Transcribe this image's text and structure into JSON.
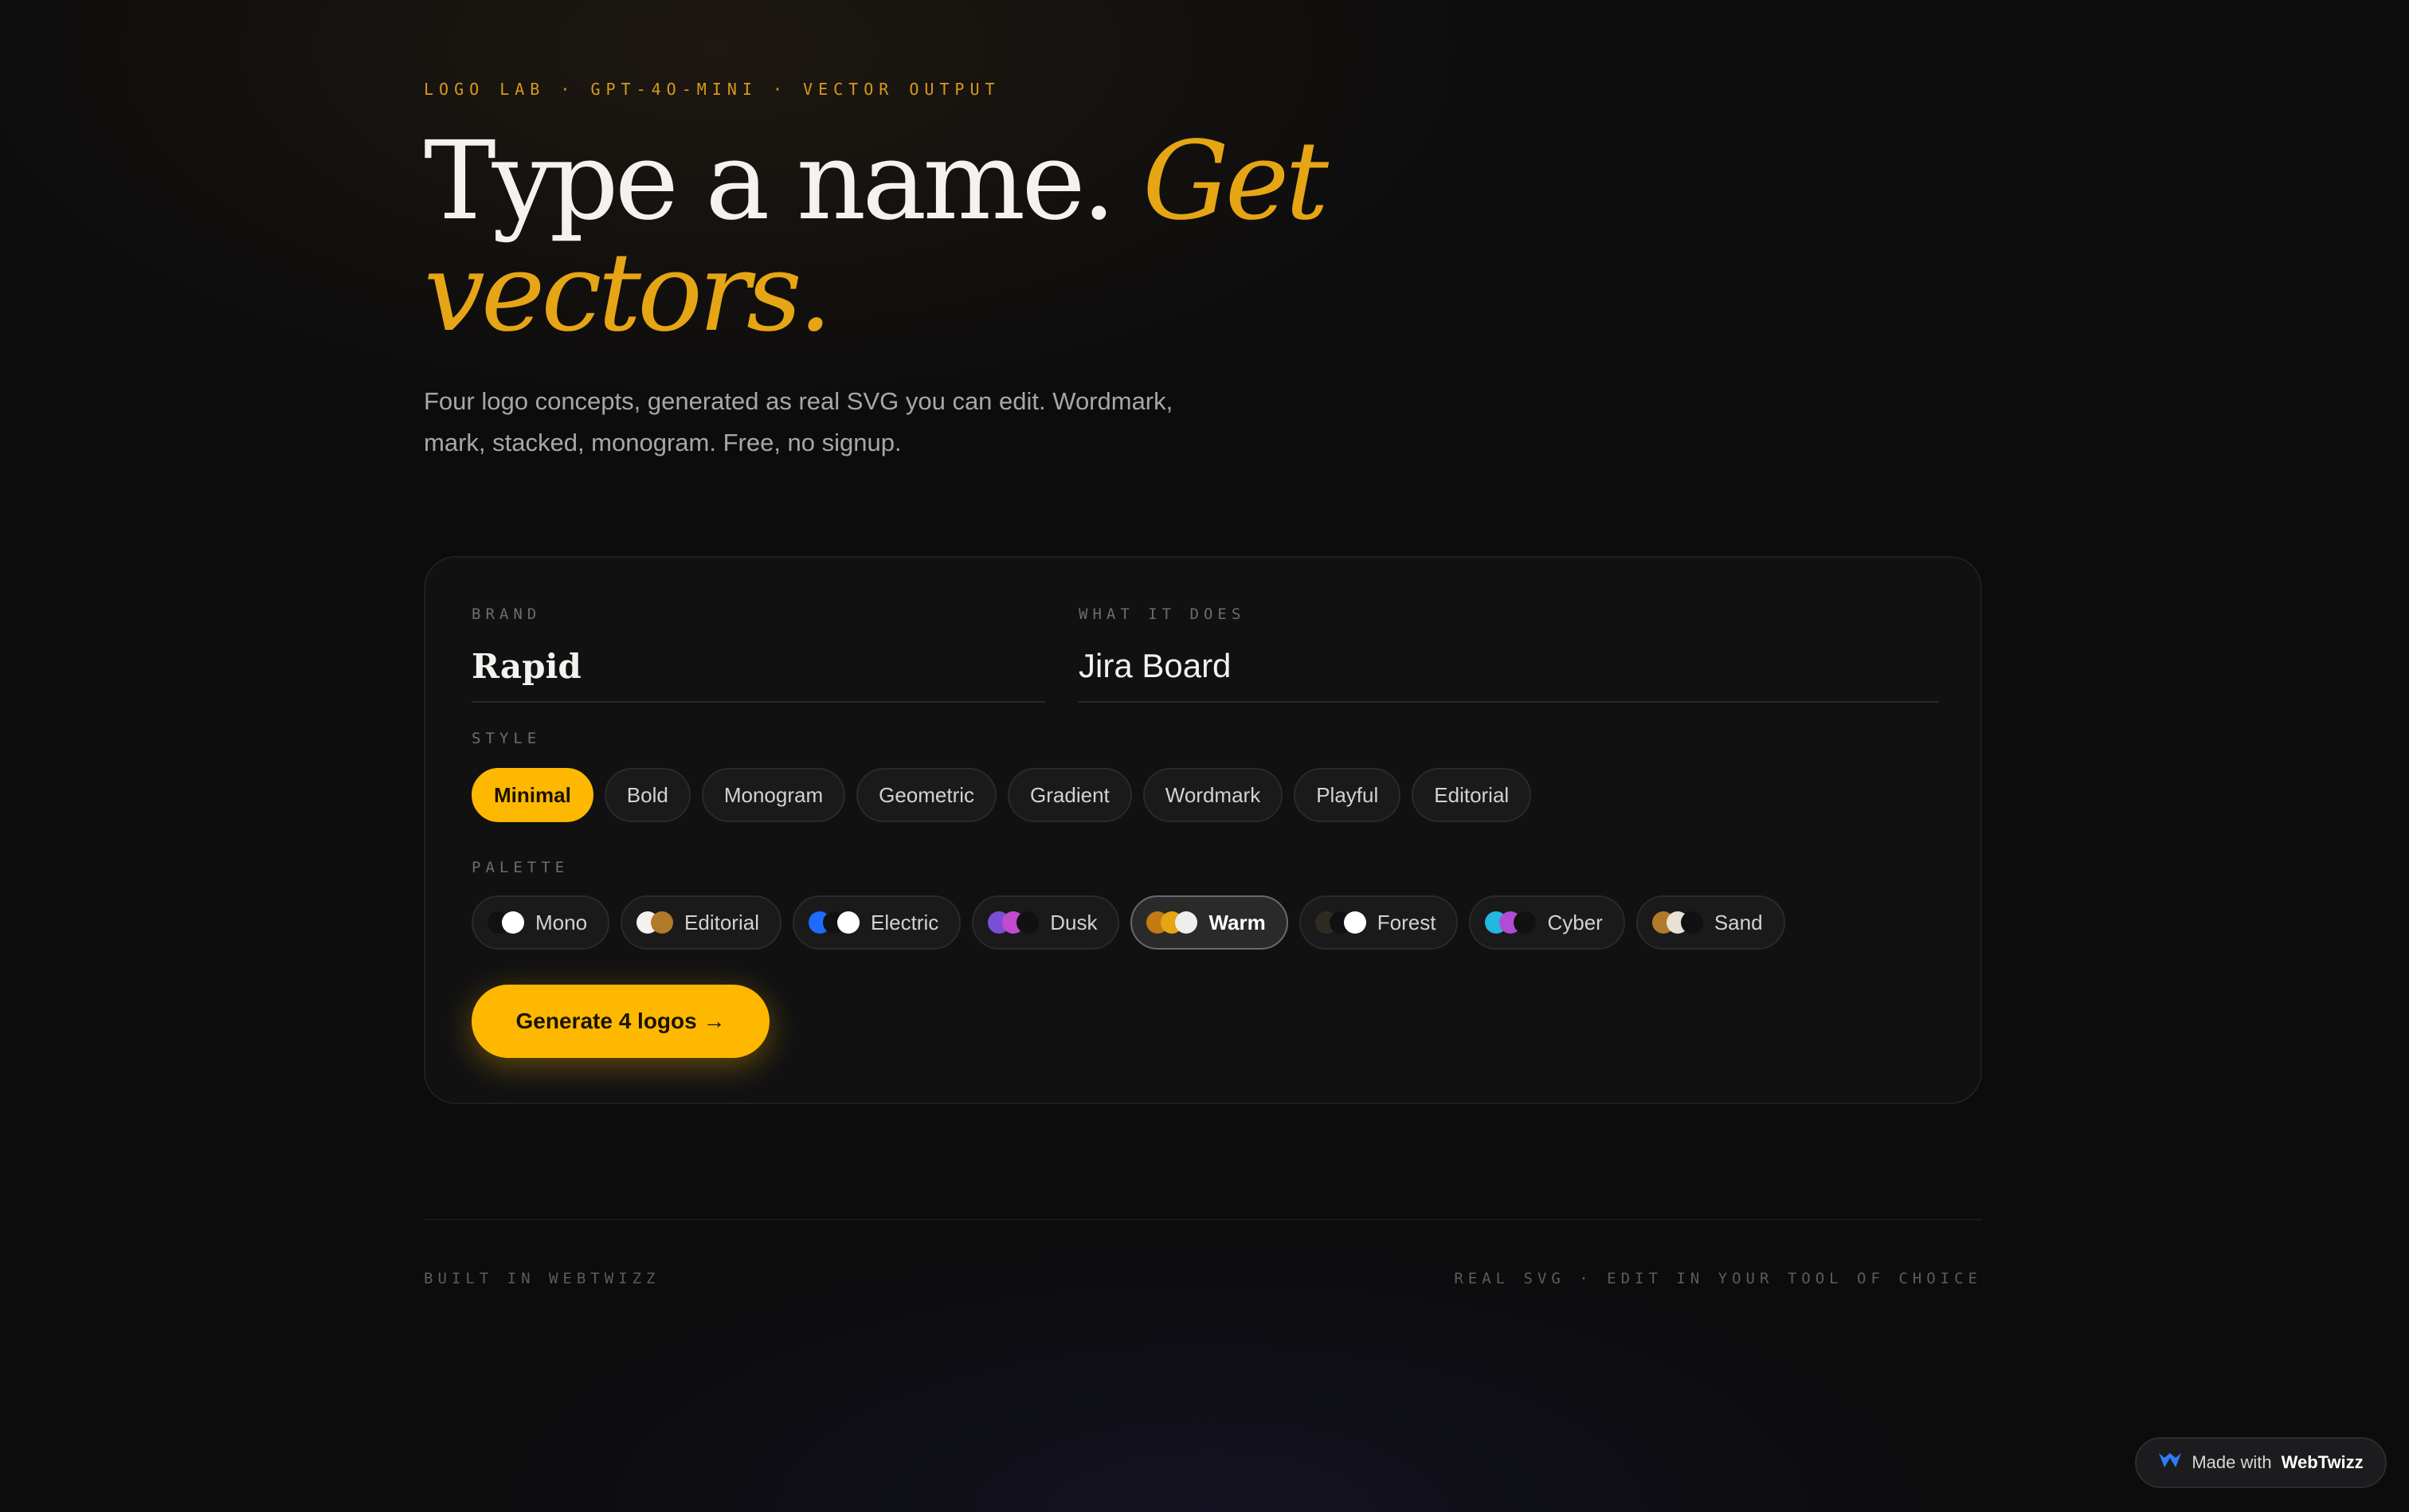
{
  "eyebrow": "LOGO LAB · GPT-4O-MINI · VECTOR OUTPUT",
  "headline": {
    "line1": "Type a name.",
    "accent1": "Get",
    "accent2": "vectors."
  },
  "lead": "Four logo concepts, generated as real SVG you can edit. Wordmark, mark, stacked, monogram. Free, no signup.",
  "form": {
    "brand_label": "BRAND",
    "brand_value": "Rapid",
    "does_label": "WHAT IT DOES",
    "does_value": "Jira Board",
    "style_label": "STYLE",
    "styles": [
      "Minimal",
      "Bold",
      "Monogram",
      "Geometric",
      "Gradient",
      "Wordmark",
      "Playful",
      "Editorial"
    ],
    "selected_style": "Minimal",
    "palette_label": "PALETTE",
    "palettes": [
      {
        "name": "Mono",
        "colors": [
          "#111111",
          "#ffffff"
        ]
      },
      {
        "name": "Editorial",
        "colors": [
          "#f4f2ee",
          "#b07a2a"
        ]
      },
      {
        "name": "Electric",
        "colors": [
          "#1e6bff",
          "#111111",
          "#ffffff"
        ]
      },
      {
        "name": "Dusk",
        "colors": [
          "#7a4fd6",
          "#c24bd0",
          "#111111"
        ]
      },
      {
        "name": "Warm",
        "colors": [
          "#c47a10",
          "#e6a515",
          "#eeeeee"
        ]
      },
      {
        "name": "Forest",
        "colors": [
          "#2e2c22",
          "#111111",
          "#ffffff"
        ]
      },
      {
        "name": "Cyber",
        "colors": [
          "#22b8e0",
          "#b24bd6",
          "#111111"
        ]
      },
      {
        "name": "Sand",
        "colors": [
          "#b07a2a",
          "#e8e2d6",
          "#111111"
        ]
      }
    ],
    "selected_palette": "Warm",
    "generate_label": "Generate 4 logos →"
  },
  "footer": {
    "left": "BUILT IN WEBTWIZZ",
    "right": "REAL SVG · EDIT IN YOUR TOOL OF CHOICE"
  },
  "badge": {
    "prefix": "Made with",
    "brand": "WebTwizz"
  },
  "colors": {
    "accent": "#ffb800",
    "background": "#0c0c0d",
    "card": "#111112"
  }
}
